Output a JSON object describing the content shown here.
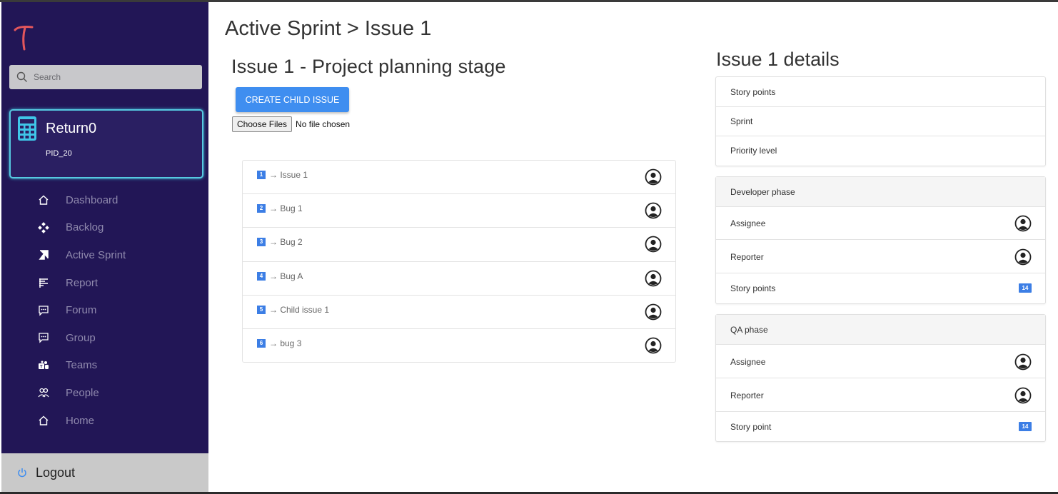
{
  "sidebar": {
    "search_placeholder": "Search",
    "project": {
      "name": "Return0",
      "id": "PID_20"
    },
    "items": [
      {
        "label": "Dashboard",
        "icon": "home-icon"
      },
      {
        "label": "Backlog",
        "icon": "diamond-grid-icon"
      },
      {
        "label": "Active Sprint",
        "icon": "sprint-icon"
      },
      {
        "label": "Report",
        "icon": "report-icon"
      },
      {
        "label": "Forum",
        "icon": "chat-icon"
      },
      {
        "label": "Group",
        "icon": "chat-icon"
      },
      {
        "label": "Teams",
        "icon": "teams-icon"
      },
      {
        "label": "People",
        "icon": "people-icon"
      },
      {
        "label": "Home",
        "icon": "home-icon"
      }
    ],
    "logout_label": "Logout"
  },
  "main": {
    "breadcrumb": "Active Sprint > Issue 1",
    "issue_title": "Issue 1 - Project planning stage",
    "create_child_label": "CREATE CHILD ISSUE",
    "file_button_label": "Choose Files",
    "file_status": "No file chosen",
    "child_issues": [
      {
        "num": "1",
        "text": "→ Issue 1"
      },
      {
        "num": "2",
        "text": "→ Bug 1"
      },
      {
        "num": "3",
        "text": "→ Bug 2"
      },
      {
        "num": "4",
        "text": "→ Bug A"
      },
      {
        "num": "5",
        "text": "→ Child issue 1"
      },
      {
        "num": "6",
        "text": "→ bug 3"
      }
    ]
  },
  "details": {
    "title": "Issue 1 details",
    "general": {
      "story_points": "Story points",
      "sprint": "Sprint",
      "priority": "Priority level"
    },
    "developer": {
      "header": "Developer phase",
      "assignee": "Assignee",
      "reporter": "Reporter",
      "story_points": "Story points",
      "points_value": "14"
    },
    "qa": {
      "header": "QA phase",
      "assignee": "Assignee",
      "reporter": "Reporter",
      "story_point": "Story point",
      "points_value": "14"
    }
  },
  "colors": {
    "sidebar_bg": "#221656",
    "accent": "#3f8ef0",
    "logo": "#e2565c",
    "project_border": "#56c9e0"
  }
}
